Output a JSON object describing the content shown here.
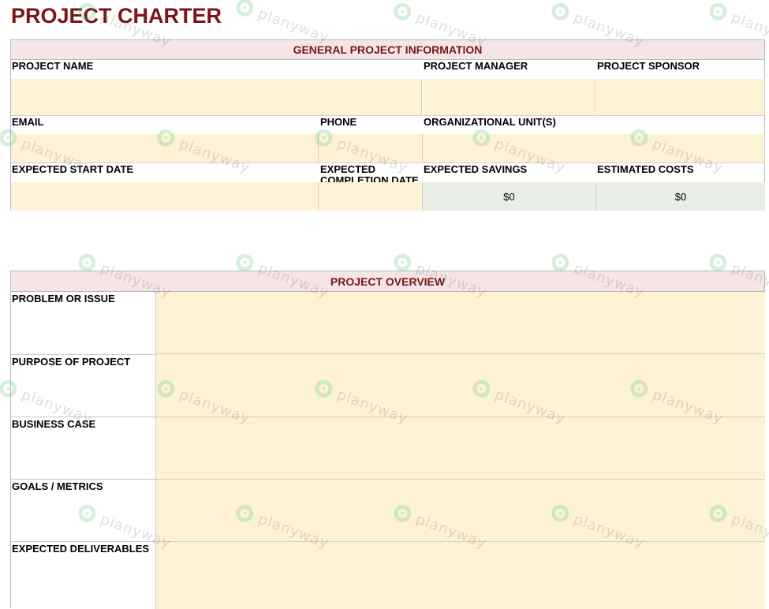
{
  "title": "PROJECT CHARTER",
  "general": {
    "header": "GENERAL PROJECT INFORMATION",
    "project_name_label": "PROJECT NAME",
    "project_manager_label": "PROJECT MANAGER",
    "project_sponsor_label": "PROJECT SPONSOR",
    "email_label": "EMAIL",
    "phone_label": "PHONE",
    "org_unit_label": "ORGANIZATIONAL UNIT(S)",
    "start_date_label": "EXPECTED START DATE",
    "completion_date_label": "EXPECTED COMPLETION DATE",
    "savings_label": "EXPECTED SAVINGS",
    "costs_label": "ESTIMATED COSTS",
    "savings_value": "$0",
    "costs_value": "$0",
    "project_name_value": "",
    "project_manager_value": "",
    "project_sponsor_value": "",
    "email_value": "",
    "phone_value": "",
    "org_unit_value": "",
    "start_date_value": "",
    "completion_date_value": ""
  },
  "overview": {
    "header": "PROJECT OVERVIEW",
    "rows": [
      {
        "label": "PROBLEM OR ISSUE",
        "value": ""
      },
      {
        "label": "PURPOSE OF PROJECT",
        "value": ""
      },
      {
        "label": "BUSINESS CASE",
        "value": ""
      },
      {
        "label": "GOALS / METRICS",
        "value": ""
      },
      {
        "label": "EXPECTED DELIVERABLES",
        "value": ""
      }
    ]
  },
  "watermark": {
    "text": "planyway",
    "color": "#3fbf6a"
  },
  "colors": {
    "title": "#7b1518",
    "header_bg": "#f4e6e6",
    "input_bg": "#fdf3d4",
    "calc_bg": "#e9efe6"
  }
}
